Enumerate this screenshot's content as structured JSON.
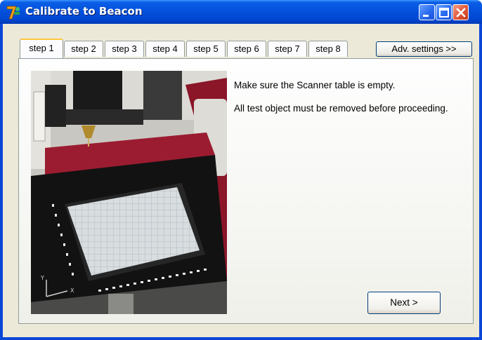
{
  "window": {
    "title": "Calibrate to Beacon"
  },
  "tabs": [
    {
      "label": "step 1",
      "active": true
    },
    {
      "label": "step 2",
      "active": false
    },
    {
      "label": "step 3",
      "active": false
    },
    {
      "label": "step 4",
      "active": false
    },
    {
      "label": "step 5",
      "active": false
    },
    {
      "label": "step 6",
      "active": false
    },
    {
      "label": "step 7",
      "active": false
    },
    {
      "label": "step 8",
      "active": false
    }
  ],
  "adv_settings_label": "Adv. settings >>",
  "content": {
    "message1": "Make sure the Scanner table is empty.",
    "message2": "All test object must be removed before proceeding.",
    "next_label": "Next >"
  },
  "photo": {
    "axis_y": "Y",
    "axis_x": "X"
  },
  "colors": {
    "titlebar": "#0451dd",
    "window_bg": "#ece9d8",
    "close_button": "#e0573a",
    "active_tab_accent": "#ffc83c",
    "machine_red": "#8c1a2c"
  },
  "icons": [
    "app-logo-icon",
    "minimize-icon",
    "maximize-icon",
    "close-icon"
  ]
}
